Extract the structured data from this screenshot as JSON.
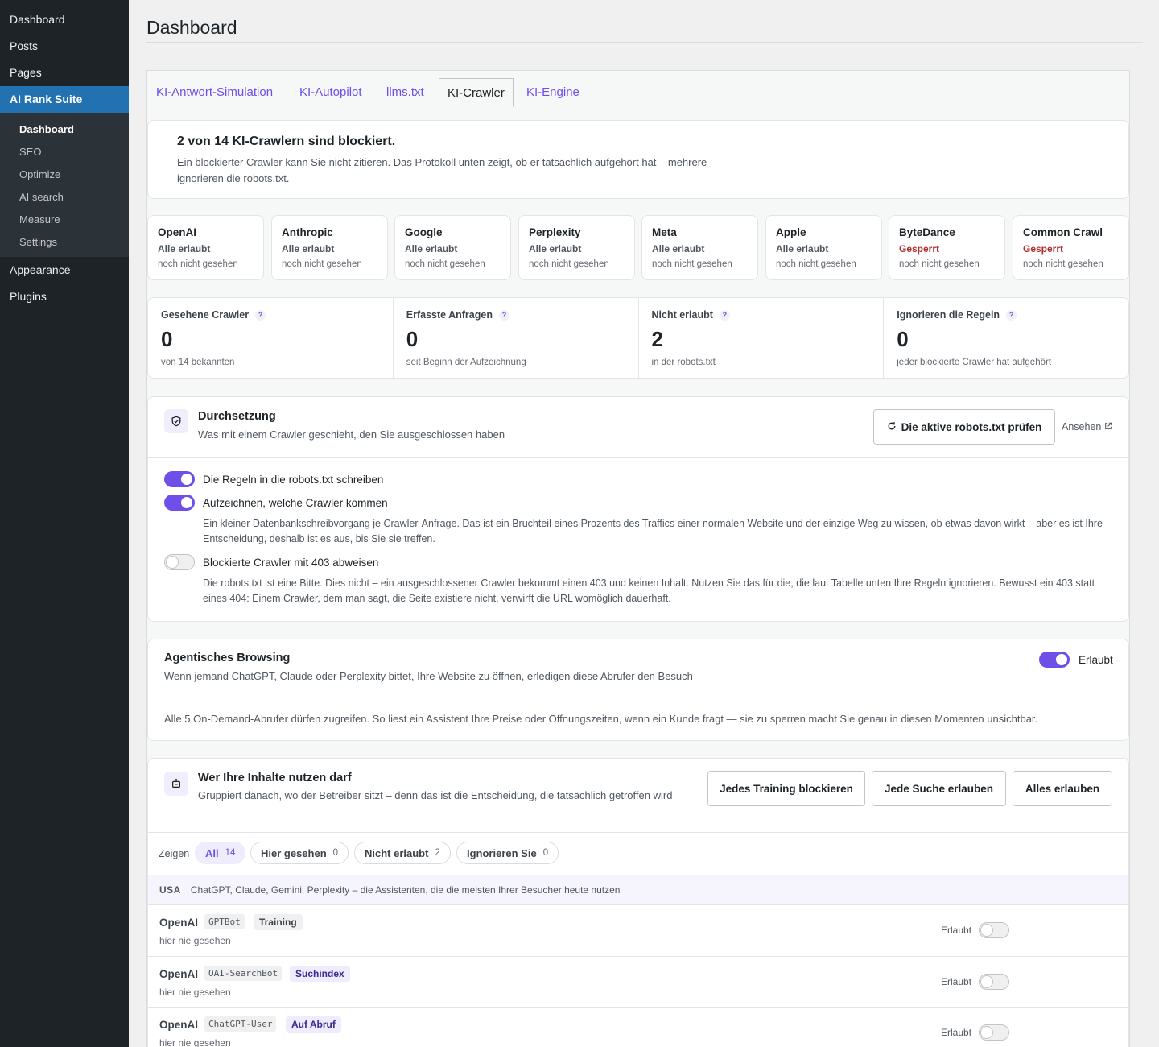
{
  "sidebar": {
    "items_top": [
      "Dashboard",
      "Posts",
      "Pages"
    ],
    "active_item": "AI Rank Suite",
    "sub_items": [
      "Dashboard",
      "SEO",
      "Optimize",
      "AI search",
      "Measure",
      "Settings"
    ],
    "items_bottom": [
      "Appearance",
      "Plugins"
    ]
  },
  "page": {
    "title": "Dashboard"
  },
  "tabs": [
    "KI-Antwort-Simulation",
    "KI-Autopilot",
    "llms.txt",
    "KI-Crawler",
    "KI-Engine"
  ],
  "summary": {
    "title": "2 von 14 KI-Crawlern sind blockiert.",
    "text": "Ein blockierter Crawler kann Sie nicht zitieren. Das Protokoll unten zeigt, ob er tatsächlich aufgehört hat – mehrere ignorieren die robots.txt."
  },
  "vendors": [
    {
      "name": "OpenAI",
      "status": "Alle erlaubt",
      "seen": "noch nicht gesehen",
      "blocked": false
    },
    {
      "name": "Anthropic",
      "status": "Alle erlaubt",
      "seen": "noch nicht gesehen",
      "blocked": false
    },
    {
      "name": "Google",
      "status": "Alle erlaubt",
      "seen": "noch nicht gesehen",
      "blocked": false
    },
    {
      "name": "Perplexity",
      "status": "Alle erlaubt",
      "seen": "noch nicht gesehen",
      "blocked": false
    },
    {
      "name": "Meta",
      "status": "Alle erlaubt",
      "seen": "noch nicht gesehen",
      "blocked": false
    },
    {
      "name": "Apple",
      "status": "Alle erlaubt",
      "seen": "noch nicht gesehen",
      "blocked": false
    },
    {
      "name": "ByteDance",
      "status": "Gesperrt",
      "seen": "noch nicht gesehen",
      "blocked": true
    },
    {
      "name": "Common Crawl",
      "status": "Gesperrt",
      "seen": "noch nicht gesehen",
      "blocked": true
    }
  ],
  "stats": [
    {
      "label": "Gesehene Crawler",
      "value": "0",
      "sub": "von 14 bekannten"
    },
    {
      "label": "Erfasste Anfragen",
      "value": "0",
      "sub": "seit Beginn der Aufzeichnung"
    },
    {
      "label": "Nicht erlaubt",
      "value": "2",
      "sub": "in der robots.txt"
    },
    {
      "label": "Ignorieren die Regeln",
      "value": "0",
      "sub": "jeder blockierte Crawler hat aufgehört"
    }
  ],
  "help_glyph": "?",
  "enforcement": {
    "title": "Durchsetzung",
    "subtitle": "Was mit einem Crawler geschieht, den Sie ausgeschlossen haben",
    "check_button": "Die aktive robots.txt prüfen",
    "view_link": "Ansehen",
    "opt1": {
      "label": "Die Regeln in die robots.txt schreiben",
      "on": true
    },
    "opt2": {
      "label": "Aufzeichnen, welche Crawler kommen",
      "on": true,
      "desc": "Ein kleiner Datenbankschreibvorgang je Crawler-Anfrage. Das ist ein Bruchteil eines Prozents des Traffics einer normalen Website und der einzige Weg zu wissen, ob etwas davon wirkt – aber es ist Ihre Entscheidung, deshalb ist es aus, bis Sie sie treffen."
    },
    "opt3": {
      "label": "Blockierte Crawler mit 403 abweisen",
      "on": false,
      "desc": "Die robots.txt ist eine Bitte. Dies nicht – ein ausgeschlossener Crawler bekommt einen 403 und keinen Inhalt. Nutzen Sie das für die, die laut Tabelle unten Ihre Regeln ignorieren. Bewusst ein 403 statt eines 404: Einem Crawler, dem man sagt, die Seite existiere nicht, verwirft die URL womöglich dauerhaft."
    }
  },
  "agentic": {
    "title": "Agentisches Browsing",
    "subtitle": "Wenn jemand ChatGPT, Claude oder Perplexity bittet, Ihre Website zu öffnen, erledigen diese Abrufer den Besuch",
    "toggle_label": "Erlaubt",
    "body": "Alle 5 On-Demand-Abrufer dürfen zugreifen. So liest ein Assistent Ihre Preise oder Öffnungszeiten, wenn ein Kunde fragt — sie zu sperren macht Sie genau in diesen Momenten unsichtbar."
  },
  "usage": {
    "title": "Wer Ihre Inhalte nutzen darf",
    "subtitle": "Gruppiert danach, wo der Betreiber sitzt – denn das ist die Entscheidung, die tatsächlich getroffen wird",
    "buttons": [
      "Jedes Training blockieren",
      "Jede Suche erlauben",
      "Alles erlauben"
    ],
    "filter_label": "Zeigen",
    "filters": [
      {
        "label": "All",
        "count": "14"
      },
      {
        "label": "Hier gesehen",
        "count": "0"
      },
      {
        "label": "Nicht erlaubt",
        "count": "2"
      },
      {
        "label": "Ignorieren Sie",
        "count": "0"
      }
    ],
    "group": {
      "key": "USA",
      "desc": "ChatGPT, Claude, Gemini, Perplexity – die Assistenten, die die meisten Ihrer Besucher heute nutzen"
    },
    "bots": [
      {
        "vendor": "OpenAI",
        "ua": "GPTBot",
        "tag": "Training",
        "seen": "hier nie gesehen",
        "allow_label": "Erlaubt"
      },
      {
        "vendor": "OpenAI",
        "ua": "OAI-SearchBot",
        "tag": "Suchindex",
        "seen": "hier nie gesehen",
        "allow_label": "Erlaubt"
      },
      {
        "vendor": "OpenAI",
        "ua": "ChatGPT-User",
        "tag": "Auf Abruf",
        "seen": "hier nie gesehen",
        "allow_label": "Erlaubt"
      }
    ]
  },
  "colors": {
    "accent": "#6e4fe8",
    "blocked": "#b32d2e",
    "wp_blue": "#2271b1",
    "sidebar": "#1d2327"
  }
}
